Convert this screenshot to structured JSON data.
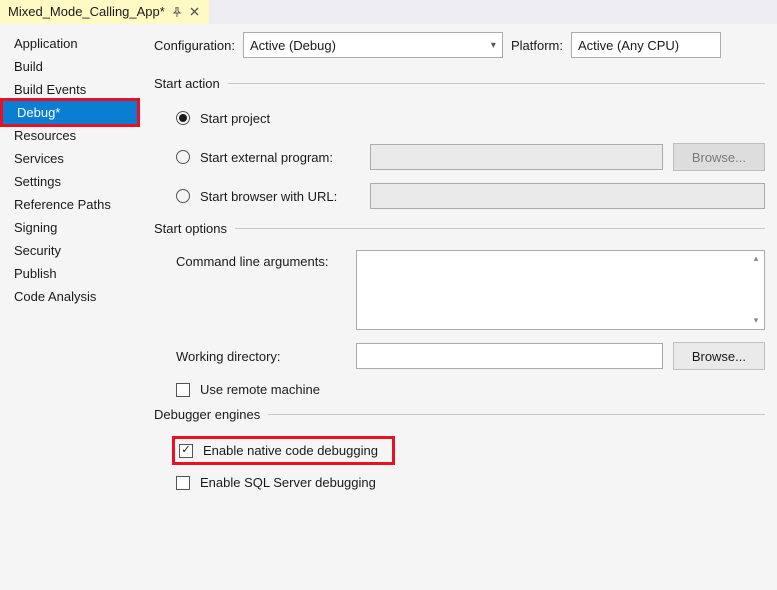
{
  "tab": {
    "title": "Mixed_Mode_Calling_App*"
  },
  "sidebar": {
    "items": [
      {
        "label": "Application"
      },
      {
        "label": "Build"
      },
      {
        "label": "Build Events"
      },
      {
        "label": "Debug*"
      },
      {
        "label": "Resources"
      },
      {
        "label": "Services"
      },
      {
        "label": "Settings"
      },
      {
        "label": "Reference Paths"
      },
      {
        "label": "Signing"
      },
      {
        "label": "Security"
      },
      {
        "label": "Publish"
      },
      {
        "label": "Code Analysis"
      }
    ],
    "selectedIndex": 3
  },
  "config": {
    "configLabel": "Configuration:",
    "configValue": "Active (Debug)",
    "platformLabel": "Platform:",
    "platformValue": "Active (Any CPU)"
  },
  "sections": {
    "startAction": "Start action",
    "startOptions": "Start options",
    "debuggerEngines": "Debugger engines"
  },
  "startAction": {
    "startProject": "Start project",
    "startExternal": "Start external program:",
    "startBrowser": "Start browser with URL:",
    "browse": "Browse..."
  },
  "startOptions": {
    "cmdArgsLabel": "Command line arguments:",
    "workDirLabel": "Working directory:",
    "browse": "Browse...",
    "useRemote": "Use remote machine"
  },
  "debugger": {
    "enableNative": "Enable native code debugging",
    "enableSql": "Enable SQL Server debugging"
  }
}
